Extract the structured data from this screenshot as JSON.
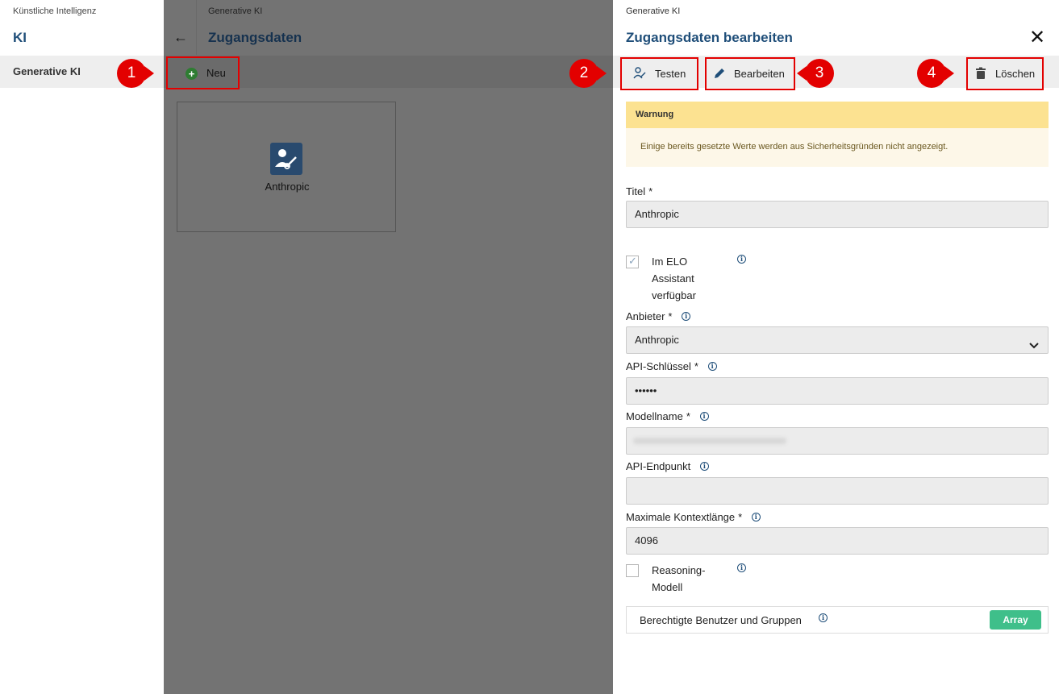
{
  "sidebar": {
    "breadcrumb": "Künstliche Intelligenz",
    "title": "KI",
    "items": [
      {
        "label": "Generative KI"
      }
    ]
  },
  "middle": {
    "breadcrumb": "Generative KI",
    "title": "Zugangsdaten",
    "new_label": "Neu",
    "tiles": [
      {
        "label": "Anthropic"
      }
    ]
  },
  "panel": {
    "breadcrumb": "Generative KI",
    "title": "Zugangsdaten bearbeiten",
    "close_glyph": "✕",
    "toolbar": {
      "test_label": "Testen",
      "edit_label": "Bearbeiten",
      "delete_label": "Löschen"
    },
    "warning": {
      "title": "Warnung",
      "message": "Einige bereits gesetzte Werte werden aus Sicherheitsgründen nicht angezeigt."
    },
    "fields": {
      "title_label": "Titel",
      "title_value": "Anthropic",
      "assistant_label": "Im ELO Assistant verfügbar",
      "assistant_checked": true,
      "provider_label": "Anbieter",
      "provider_value": "Anthropic",
      "api_key_label": "API-Schlüssel",
      "api_key_value": "••••••",
      "model_label": "Modellname",
      "endpoint_label": "API-Endpunkt",
      "endpoint_value": "",
      "context_label": "Maximale Kontextlänge",
      "context_value": "4096",
      "reasoning_label": "Reasoning-Modell",
      "reasoning_checked": false
    },
    "permissions": {
      "label": "Berechtigte Benutzer und Gruppen",
      "badge": "Array"
    },
    "required_marker": "*"
  },
  "callouts": [
    "1",
    "2",
    "3",
    "4"
  ],
  "colors": {
    "accent": "#1f4e79",
    "highlight": "#e30000",
    "warning_header": "#fce291",
    "badge": "#3fbf8a",
    "overlay": "#737373"
  }
}
